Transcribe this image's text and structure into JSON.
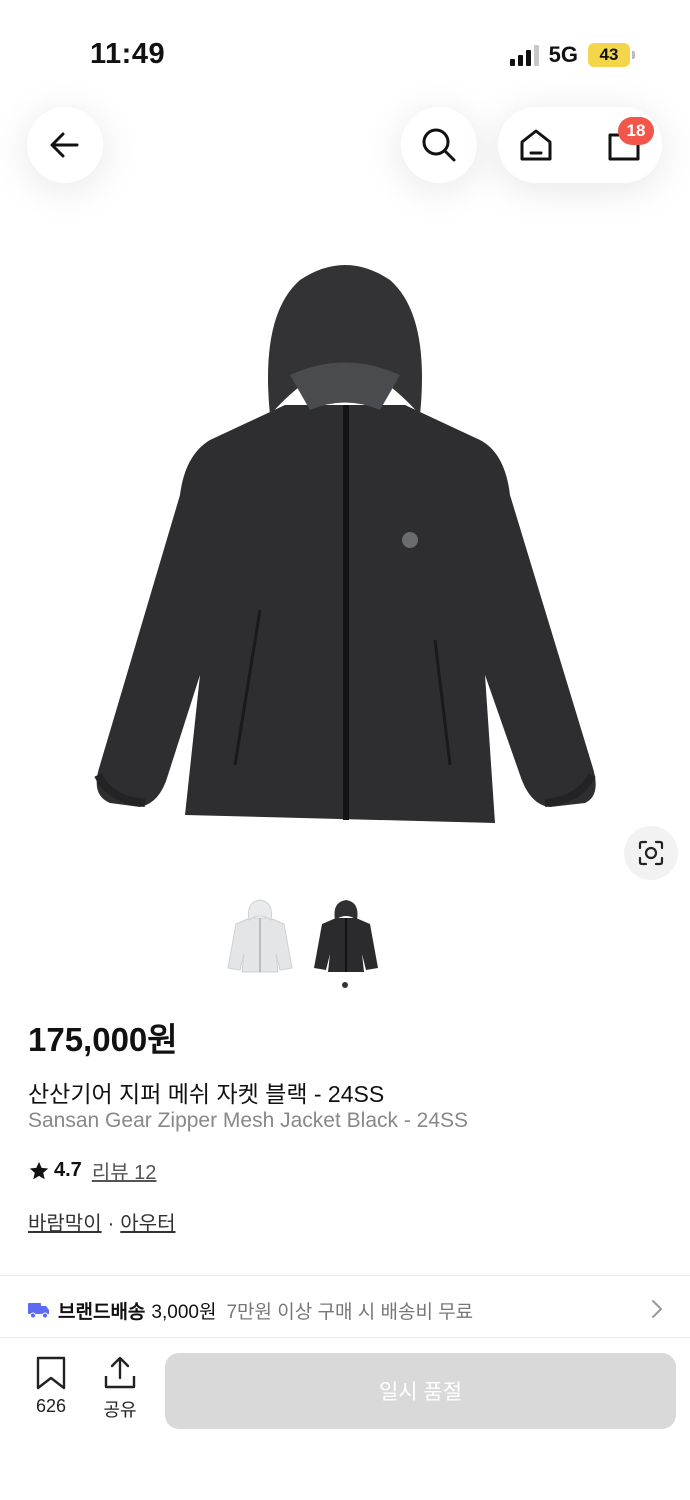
{
  "status_bar": {
    "time": "11:49",
    "network": "5G",
    "battery": "43"
  },
  "nav": {
    "back_icon": "arrow-left-icon",
    "search_icon": "search-icon",
    "home_icon": "home-icon",
    "cart_icon": "cart-icon",
    "cart_count": "18"
  },
  "product": {
    "image": "black-hooded-zip-jacket",
    "thumbnails": [
      {
        "name": "light-grey-jacket-thumbnail",
        "color": "#e3e5e7"
      },
      {
        "name": "black-jacket-thumbnail",
        "color": "#2b2b2d"
      }
    ],
    "price": "175,000원",
    "title_ko": "산산기어 지퍼 메쉬 자켓 블랙 - 24SS",
    "title_en": "Sansan Gear Zipper Mesh Jacket Black - 24SS",
    "rating": "4.7",
    "review_label": "리뷰 12",
    "categories": [
      "바람막이",
      "아우터"
    ],
    "category_separator": "·"
  },
  "shipping": {
    "label": "브랜드배송",
    "fee": "3,000원",
    "note": "7만원 이상 구매 시 배송비 무료"
  },
  "bottom_bar": {
    "bookmark_count": "626",
    "share_label": "공유",
    "soldout_label": "일시 품절"
  },
  "colors": {
    "badge": "#f2554a",
    "shipping_icon": "#5b6cf2",
    "soldout_bg": "#d9d9d9",
    "battery": "#f5d64a"
  }
}
